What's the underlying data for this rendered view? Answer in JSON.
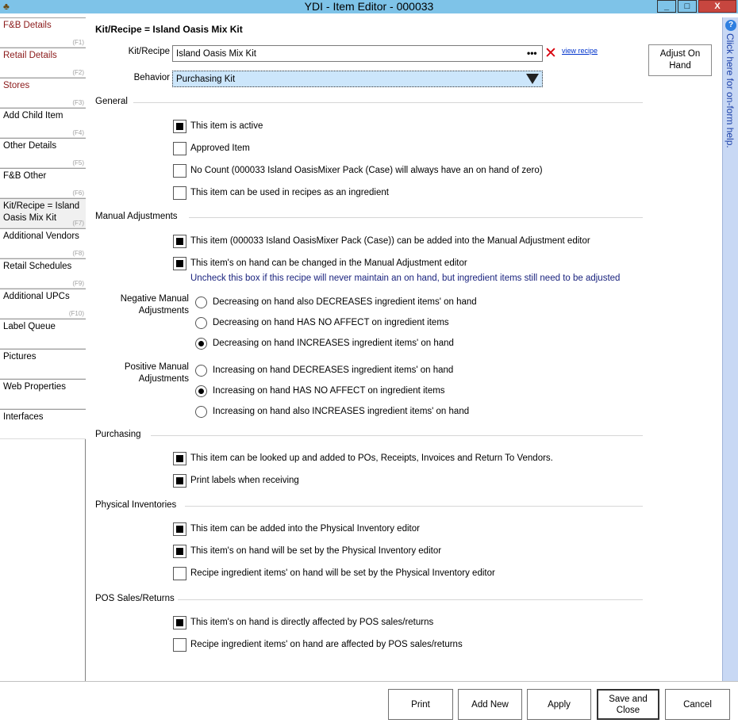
{
  "window": {
    "title": "YDI - Item Editor - 000033",
    "minimize": "_",
    "maximize": "□",
    "close": "X"
  },
  "nav": {
    "items": [
      {
        "label": "F&B Details",
        "key": "(F1)"
      },
      {
        "label": "Retail Details",
        "key": "(F2)"
      },
      {
        "label": "Stores",
        "key": "(F3)"
      },
      {
        "label": "Add Child Item",
        "key": "(F4)"
      },
      {
        "label": "Other Details",
        "key": "(F5)"
      },
      {
        "label": "F&B Other",
        "key": "(F6)"
      },
      {
        "label": "Kit/Recipe = Island Oasis Mix Kit",
        "key": "(F7)"
      },
      {
        "label": "Additional Vendors",
        "key": "(F8)"
      },
      {
        "label": "Retail Schedules",
        "key": "(F9)"
      },
      {
        "label": "Additional UPCs",
        "key": "(F10)"
      },
      {
        "label": "Label Queue",
        "key": ""
      },
      {
        "label": "Pictures",
        "key": ""
      },
      {
        "label": "Web Properties",
        "key": ""
      },
      {
        "label": "Interfaces",
        "key": ""
      }
    ]
  },
  "main": {
    "section_title": "Kit/Recipe = Island Oasis Mix Kit",
    "kit_label": "Kit/Recipe",
    "kit_value": "Island Oasis Mix Kit",
    "kit_dots": "•••",
    "clear_icon": "✕",
    "view_recipe": "view recipe",
    "behavior_label": "Behavior",
    "behavior_value": "Purchasing Kit",
    "adjust_on_hand": "Adjust On Hand"
  },
  "general": {
    "header": "General",
    "active": "This item is active",
    "approved": "Approved Item",
    "no_count": "No Count (000033 Island OasisMixer Pack (Case) will always have an on hand of zero)",
    "recipes": "This item can be used in recipes as an ingredient"
  },
  "manual": {
    "header": "Manual Adjustments",
    "can_be_added": "This item (000033 Island OasisMixer Pack (Case)) can be added into the Manual Adjustment editor",
    "on_hand_changed": "This item's on hand can be changed in the Manual Adjustment editor",
    "hint": "Uncheck this box if this recipe will never maintain an on hand, but ingredient items still need to be adjusted",
    "negative_label": "Negative Manual Adjustments",
    "negative_options": [
      "Decreasing on hand also DECREASES ingredient items' on hand",
      "Decreasing on hand HAS NO AFFECT on ingredient items",
      "Decreasing on hand INCREASES ingredient items' on hand"
    ],
    "negative_selected": 2,
    "positive_label": "Positive Manual Adjustments",
    "positive_options": [
      "Increasing on hand DECREASES ingredient items' on hand",
      "Increasing on hand HAS NO AFFECT on ingredient items",
      "Increasing on hand also INCREASES ingredient items' on hand"
    ],
    "positive_selected": 1
  },
  "purchasing": {
    "header": "Purchasing",
    "lookup": "This item can be looked up and added to POs, Receipts, Invoices and Return To Vendors.",
    "print_labels": "Print labels when receiving"
  },
  "physical": {
    "header": "Physical Inventories",
    "added": "This item can be added into the Physical Inventory editor",
    "set_by": "This item's on hand will be set by the Physical Inventory editor",
    "recipe_set_by": "Recipe ingredient items' on hand will be set by the Physical Inventory editor"
  },
  "pos": {
    "header": "POS Sales/Returns",
    "affected": "This item's on hand is directly affected by POS sales/returns",
    "recipe_affected": "Recipe ingredient items' on hand are affected by POS sales/returns"
  },
  "help": {
    "icon": "?",
    "text": "Click here for on-form help."
  },
  "buttons": {
    "print": "Print",
    "add_new": "Add New",
    "apply": "Apply",
    "save_close": "Save and Close",
    "cancel": "Cancel"
  },
  "colors": {
    "titlebar": "#7ec3e8",
    "behavior_bg": "#cce6fb",
    "hint_text": "#1a237e",
    "link": "#0033cc",
    "clear_x": "#d8000c",
    "nav_red": "#8b1a1a"
  }
}
